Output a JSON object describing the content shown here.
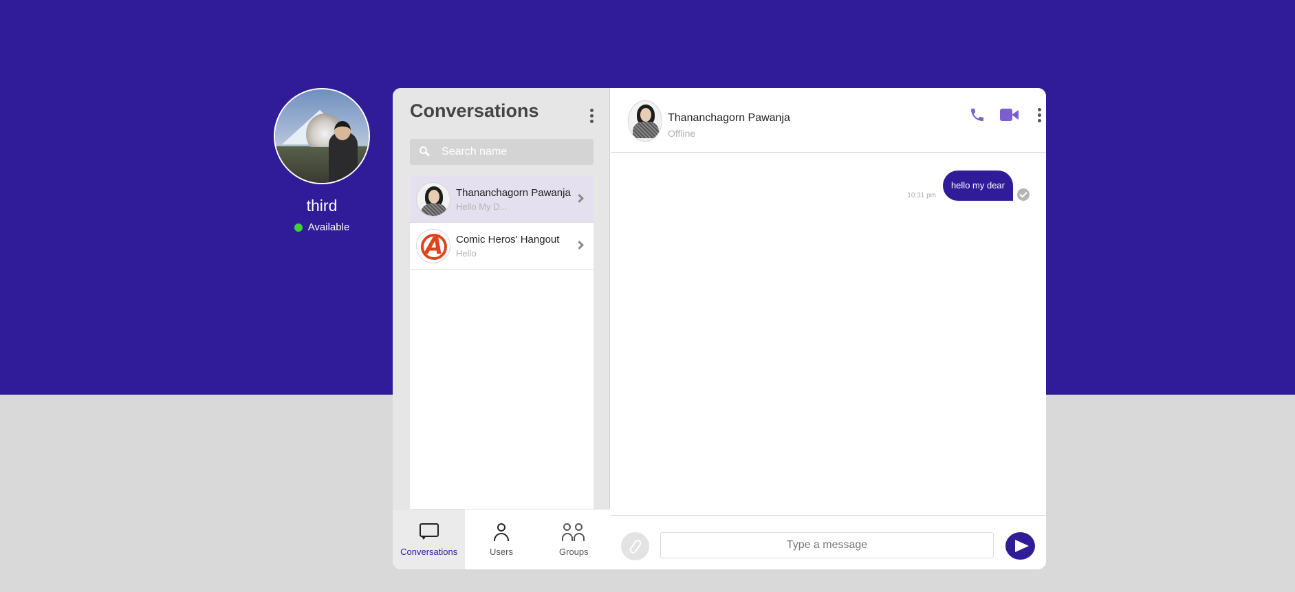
{
  "profile": {
    "name": "third",
    "status": "Available"
  },
  "sidebar": {
    "title": "Conversations",
    "search_placeholder": "Search name",
    "conversations": [
      {
        "name": "Thananchagorn Pawanja",
        "preview": "Hello My D...",
        "active": true
      },
      {
        "name": "Comic Heros' Hangout",
        "preview": "Hello",
        "active": false
      }
    ],
    "tabs": [
      {
        "label": "Conversations",
        "icon": "chat-icon",
        "active": true
      },
      {
        "label": "Users",
        "icon": "user-icon",
        "active": false
      },
      {
        "label": "Groups",
        "icon": "group-icon",
        "active": false
      }
    ]
  },
  "chat": {
    "name": "Thananchagorn Pawanja",
    "status": "Offline",
    "messages": [
      {
        "text": "hello my dear",
        "time": "10:31 pm",
        "outgoing": true
      }
    ],
    "composer_placeholder": "Type a message"
  },
  "colors": {
    "brand": "#301c98",
    "accent_icon": "#7b5fcf",
    "status_available": "#3fd13b",
    "background": "#d9d9d9"
  }
}
